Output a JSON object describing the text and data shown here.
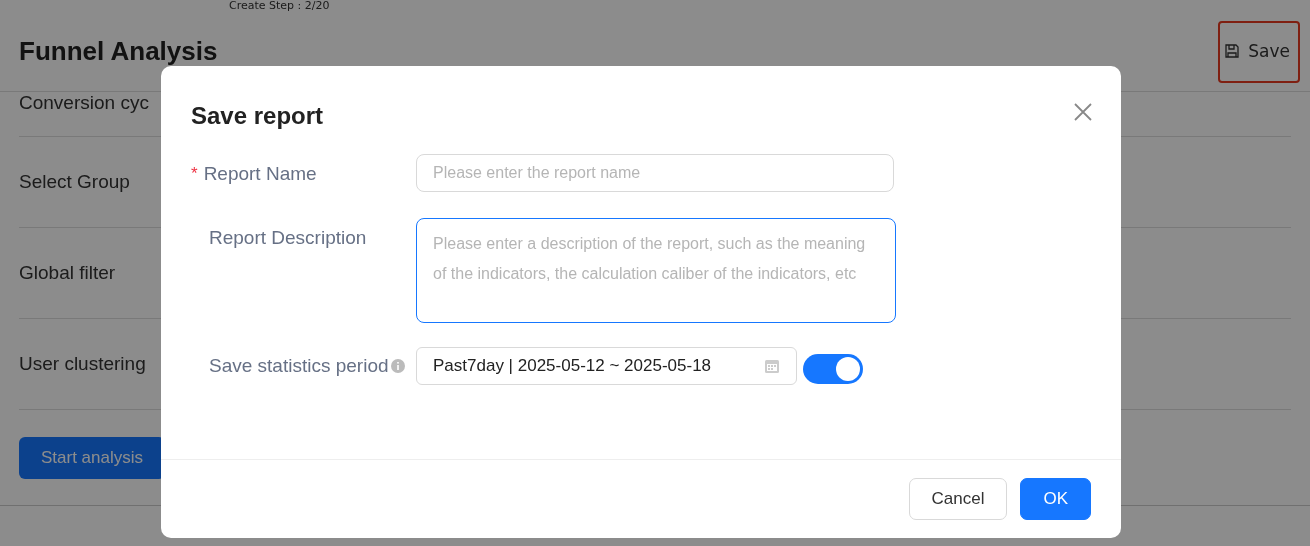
{
  "page": {
    "step_label": "Create Step : 2/20",
    "title": "Funnel Analysis",
    "save_button": {
      "label": "Save",
      "highlighted": true
    },
    "settings_rows": [
      "Conversion cyc",
      "Select Group",
      "Global filter",
      "User clustering"
    ],
    "start_button": "Start analysis"
  },
  "dialog": {
    "title": "Save report",
    "fields": [
      {
        "kind": "input",
        "label": "Report Name",
        "required_mark": "*",
        "placeholder": "Please enter the report name",
        "focused": false
      },
      {
        "kind": "textarea",
        "label": "Report Description",
        "placeholder": "Please enter a description of the report, such as the meaning of the indicators, the calculation caliber of the indicators, etc",
        "focused": true
      },
      {
        "kind": "period",
        "label": "Save statistics period",
        "value": "Past7day | 2025-05-12 ~ 2025-05-18",
        "on": true
      }
    ],
    "buttons": [
      {
        "label": "Cancel",
        "primary": false
      },
      {
        "label": "OK",
        "primary": true
      }
    ]
  }
}
